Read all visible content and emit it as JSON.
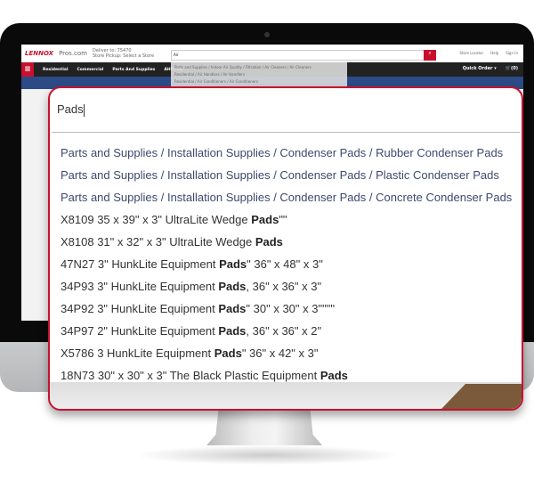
{
  "site": {
    "logo": "LENNOX",
    "logo_suffix": "Pros.com",
    "deliver": "Deliver to: 75470",
    "store_pickup": "Store Pickup: Select a Store",
    "search_value": "Air",
    "toplinks": [
      "Store Locator",
      "Help",
      "Sign In"
    ],
    "nav": [
      "Residential",
      "Commercial",
      "Parts And Supplies",
      "AHRI Ma"
    ],
    "quick_order": "Quick Order ▾",
    "cart": "🛒(0)",
    "dropdown": [
      "Parts and Supplies / Indoor Air Quality / Filtration / Air Cleaners / Air Cleaners",
      "Residential / Air Handlers / Air Handlers",
      "Residential / Air Conditioners / Air Conditioners"
    ]
  },
  "callout": {
    "search_value": "Pads",
    "results": [
      {
        "type": "category",
        "pre": "Parts and Supplies / Installation Supplies / Condenser Pads / Rubber Condenser Pads",
        "bold": "",
        "post": ""
      },
      {
        "type": "category",
        "pre": "Parts and Supplies / Installation Supplies / Condenser Pads / Plastic Condenser Pads",
        "bold": "",
        "post": ""
      },
      {
        "type": "category",
        "pre": "Parts and Supplies / Installation Supplies / Condenser Pads / Concrete Condenser Pads",
        "bold": "",
        "post": ""
      },
      {
        "type": "product",
        "pre": "X8109 35 x 39\" x 3\" UltraLite Wedge ",
        "bold": "Pads",
        "post": "\"\""
      },
      {
        "type": "product",
        "pre": "X8108 31\" x 32\" x 3\" UltraLite Wedge ",
        "bold": "Pads",
        "post": ""
      },
      {
        "type": "product",
        "pre": "47N27 3\" HunkLite Equipment ",
        "bold": "Pads",
        "post": "\" 36\" x 48\" x 3\""
      },
      {
        "type": "product",
        "pre": "34P93 3\" HunkLite Equipment ",
        "bold": "Pads",
        "post": ", 36\" x 36\" x 3\""
      },
      {
        "type": "product",
        "pre": "34P92 3\" HunkLite Equipment ",
        "bold": "Pads",
        "post": "\" 30\" x 30\" x 3\"\"\"\""
      },
      {
        "type": "product",
        "pre": "34P97 2\" HunkLite Equipment ",
        "bold": "Pads",
        "post": ", 36\" x 36\" x 2\""
      },
      {
        "type": "product",
        "pre": "X5786 3 HunkLite Equipment ",
        "bold": "Pads",
        "post": "\" 36\" x 42\" x 3\""
      },
      {
        "type": "product",
        "pre": "18N73 30\" x 30\" x 3\" The Black Plastic Equipment ",
        "bold": "Pads",
        "post": ""
      }
    ]
  },
  "colors": {
    "brand": "#c8102e",
    "category_text": "#3d4a6e",
    "nav": "#222222"
  }
}
